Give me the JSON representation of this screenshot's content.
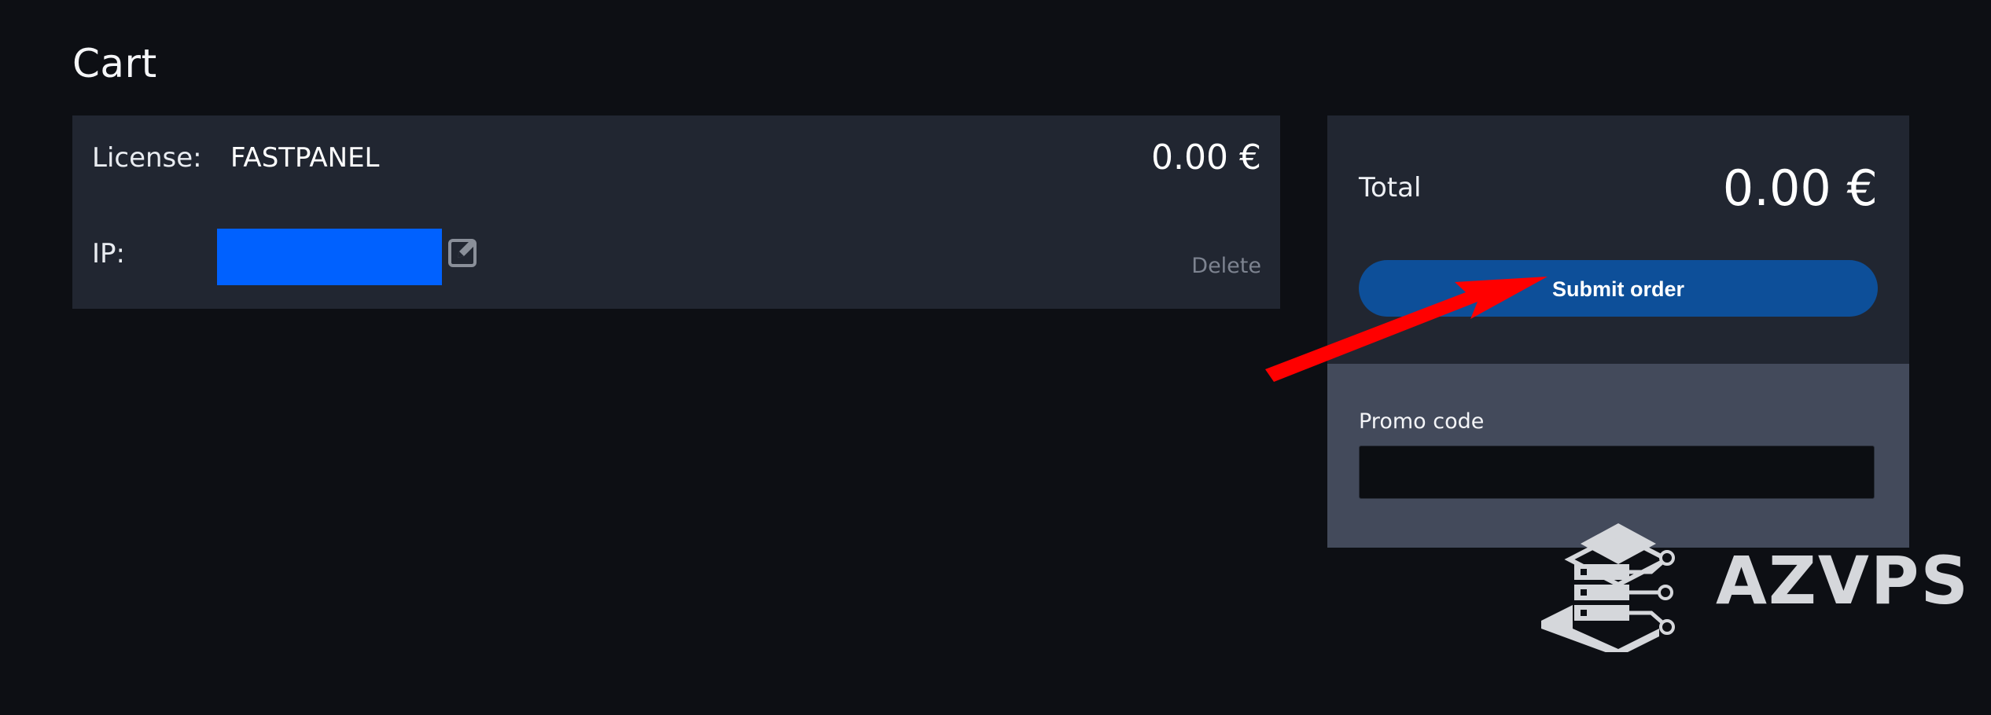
{
  "page": {
    "title": "Cart"
  },
  "cart_item": {
    "license_label": "License:",
    "license_value": "FASTPANEL",
    "price": "0.00 €",
    "ip_label": "IP:",
    "ip_value": "",
    "edit_icon": "edit-icon",
    "delete_label": "Delete"
  },
  "summary": {
    "total_label": "Total",
    "total_value": "0.00 €",
    "submit_label": "Submit order",
    "promo_label": "Promo code",
    "promo_value": ""
  },
  "watermark": {
    "text": "AZVPS",
    "icon": "server-logo-icon"
  },
  "colors": {
    "background": "#0d0f14",
    "panel": "#212631",
    "promo_panel": "#434a5b",
    "submit_button": "#0d4f99",
    "ip_redaction": "#0061ff",
    "annotation_arrow": "#ff0000"
  }
}
